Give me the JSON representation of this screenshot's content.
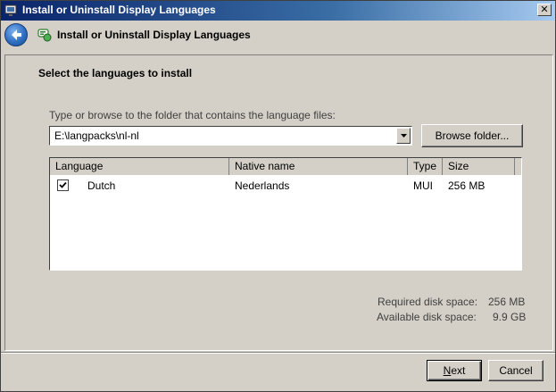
{
  "window": {
    "title": "Install or Uninstall Display Languages",
    "close_glyph": "✕"
  },
  "header": {
    "title": "Install or Uninstall Display Languages",
    "back_icon": "back-arrow-icon",
    "app_icon": "language-icon"
  },
  "main": {
    "heading": "Select the languages to install",
    "folder_label": "Type or browse to the folder that contains the language files:",
    "folder_path": "E:\\langpacks\\nl-nl",
    "browse_label": "Browse folder...",
    "table": {
      "columns": [
        "Language",
        "Native name",
        "Type",
        "Size"
      ],
      "rows": [
        {
          "checked": true,
          "language": "Dutch",
          "native_name": "Nederlands",
          "type": "MUI",
          "size": "256 MB"
        }
      ]
    },
    "disk": {
      "required_label": "Required disk space:",
      "required_value": "256 MB",
      "available_label": "Available disk space:",
      "available_value": "9.9 GB"
    }
  },
  "footer": {
    "next_prefix": "N",
    "next_rest": "ext",
    "cancel_label": "Cancel"
  }
}
